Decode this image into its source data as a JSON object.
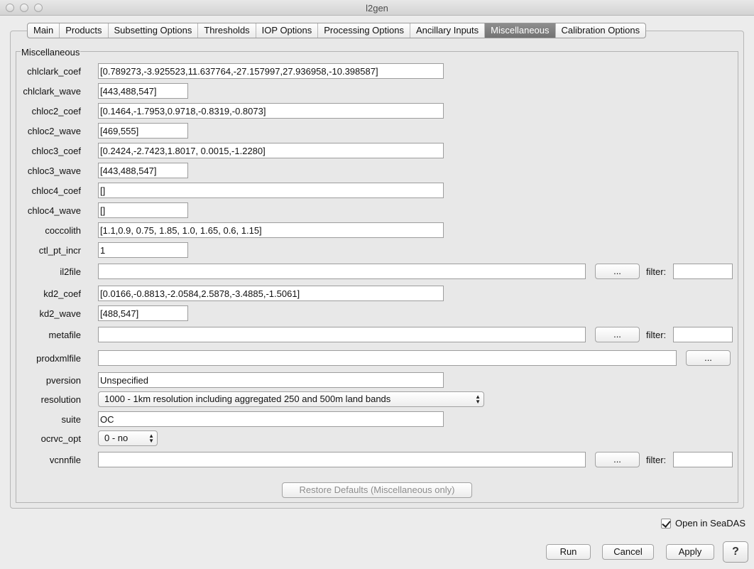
{
  "window": {
    "title": "l2gen"
  },
  "tabs": [
    {
      "label": "Main",
      "active": false
    },
    {
      "label": "Products",
      "active": false
    },
    {
      "label": "Subsetting Options",
      "active": false
    },
    {
      "label": "Thresholds",
      "active": false
    },
    {
      "label": "IOP Options",
      "active": false
    },
    {
      "label": "Processing Options",
      "active": false
    },
    {
      "label": "Ancillary Inputs",
      "active": false
    },
    {
      "label": "Miscellaneous",
      "active": true
    },
    {
      "label": "Calibration Options",
      "active": false
    }
  ],
  "group": {
    "title": "Miscellaneous"
  },
  "fields": {
    "chlclark_coef": {
      "label": "chlclark_coef",
      "value": "[0.789273,-3.925523,11.637764,-27.157997,27.936958,-10.398587]"
    },
    "chlclark_wave": {
      "label": "chlclark_wave",
      "value": "[443,488,547]"
    },
    "chloc2_coef": {
      "label": "chloc2_coef",
      "value": "[0.1464,-1.7953,0.9718,-0.8319,-0.8073]"
    },
    "chloc2_wave": {
      "label": "chloc2_wave",
      "value": "[469,555]"
    },
    "chloc3_coef": {
      "label": "chloc3_coef",
      "value": "[0.2424,-2.7423,1.8017, 0.0015,-1.2280]"
    },
    "chloc3_wave": {
      "label": "chloc3_wave",
      "value": "[443,488,547]"
    },
    "chloc4_coef": {
      "label": "chloc4_coef",
      "value": "[]"
    },
    "chloc4_wave": {
      "label": "chloc4_wave",
      "value": "[]"
    },
    "coccolith": {
      "label": "coccolith",
      "value": "[1.1,0.9, 0.75, 1.85, 1.0, 1.65, 0.6, 1.15]"
    },
    "ctl_pt_incr": {
      "label": "ctl_pt_incr",
      "value": "1"
    },
    "il2file": {
      "label": "il2file",
      "value": "",
      "browse": "...",
      "filter_label": "filter:",
      "filter_value": ""
    },
    "kd2_coef": {
      "label": "kd2_coef",
      "value": "[0.0166,-0.8813,-2.0584,2.5878,-3.4885,-1.5061]"
    },
    "kd2_wave": {
      "label": "kd2_wave",
      "value": "[488,547]"
    },
    "metafile": {
      "label": "metafile",
      "value": "",
      "browse": "...",
      "filter_label": "filter:",
      "filter_value": ""
    },
    "prodxmlfile": {
      "label": "prodxmlfile",
      "value": "",
      "browse": "..."
    },
    "pversion": {
      "label": "pversion",
      "value": "Unspecified"
    },
    "resolution": {
      "label": "resolution",
      "value": "1000 - 1km resolution including aggregated 250 and 500m land bands"
    },
    "suite": {
      "label": "suite",
      "value": "OC"
    },
    "ocrvc_opt": {
      "label": "ocrvc_opt",
      "value": "0 - no"
    },
    "vcnnfile": {
      "label": "vcnnfile",
      "value": "",
      "browse": "...",
      "filter_label": "filter:",
      "filter_value": ""
    }
  },
  "restore_defaults": "Restore Defaults (Miscellaneous only)",
  "open_in_seadas": {
    "label": "Open in SeaDAS",
    "checked": true
  },
  "footer": {
    "run": "Run",
    "cancel": "Cancel",
    "apply": "Apply",
    "help": "?"
  }
}
